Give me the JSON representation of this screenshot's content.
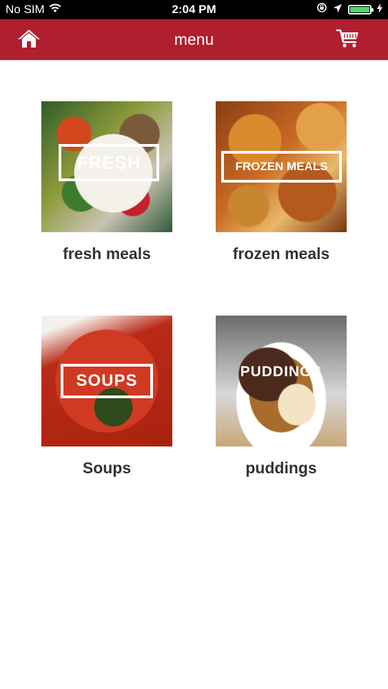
{
  "status_bar": {
    "carrier": "No SIM",
    "time": "2:04 PM",
    "battery_color": "#4cd964"
  },
  "navbar": {
    "title": "menu",
    "background": "#b01f2f",
    "home_icon": "home-icon",
    "cart_icon": "cart-icon"
  },
  "tiles": [
    {
      "label": "fresh meals",
      "image_text": "FRESH"
    },
    {
      "label": "frozen meals",
      "image_text": "FROZEN MEALS"
    },
    {
      "label": "Soups",
      "image_text": "SOUPS"
    },
    {
      "label": "puddings",
      "image_text": "PUDDINGS"
    }
  ]
}
